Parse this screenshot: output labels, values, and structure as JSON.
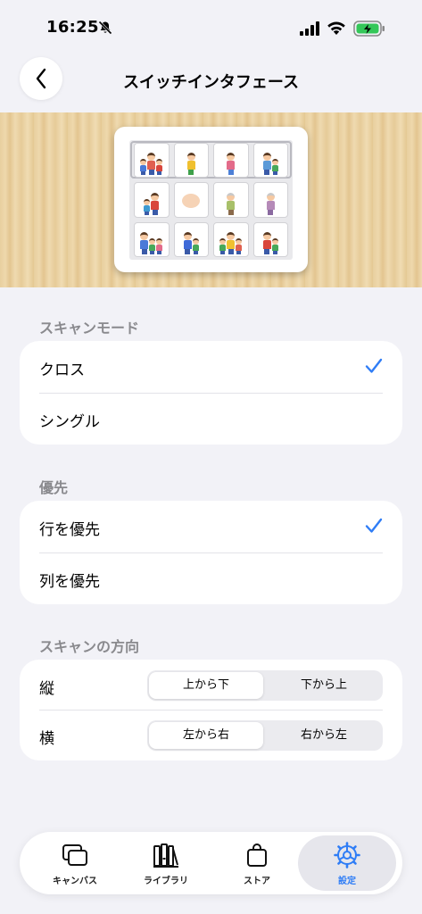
{
  "status_bar": {
    "time": "16:25",
    "icons": [
      "bell-slash-icon",
      "signal-icon",
      "wifi-icon",
      "battery-charging-icon"
    ],
    "battery_color": "#34c759"
  },
  "nav": {
    "title": "スイッチインタフェース",
    "back_icon": "chevron-left-icon"
  },
  "preview": {
    "image": "switch-scan-preview-grid",
    "rows": 3,
    "columns": 4
  },
  "sections": {
    "scan_mode": {
      "header": "スキャンモード",
      "options": [
        {
          "label": "クロス",
          "selected": true
        },
        {
          "label": "シングル",
          "selected": false
        }
      ]
    },
    "priority": {
      "header": "優先",
      "options": [
        {
          "label": "行を優先",
          "selected": true
        },
        {
          "label": "列を優先",
          "selected": false
        }
      ]
    },
    "direction": {
      "header": "スキャンの方向",
      "rows": [
        {
          "label": "縦",
          "options": [
            "上から下",
            "下から上"
          ],
          "selected": "上から下"
        },
        {
          "label": "横",
          "options": [
            "左から右",
            "右から左"
          ],
          "selected": "左から右"
        }
      ]
    }
  },
  "tabbar": {
    "tabs": [
      {
        "label": "キャンバス",
        "icon": "canvas-icon",
        "selected": false
      },
      {
        "label": "ライブラリ",
        "icon": "library-icon",
        "selected": false
      },
      {
        "label": "ストア",
        "icon": "shopping-bag-icon",
        "selected": false
      },
      {
        "label": "設定",
        "icon": "settings-gear-icon",
        "selected": true
      }
    ]
  },
  "colors": {
    "accent": "#2f7df6",
    "background": "#f2f2f7",
    "section_header": "#8a8a8e"
  }
}
